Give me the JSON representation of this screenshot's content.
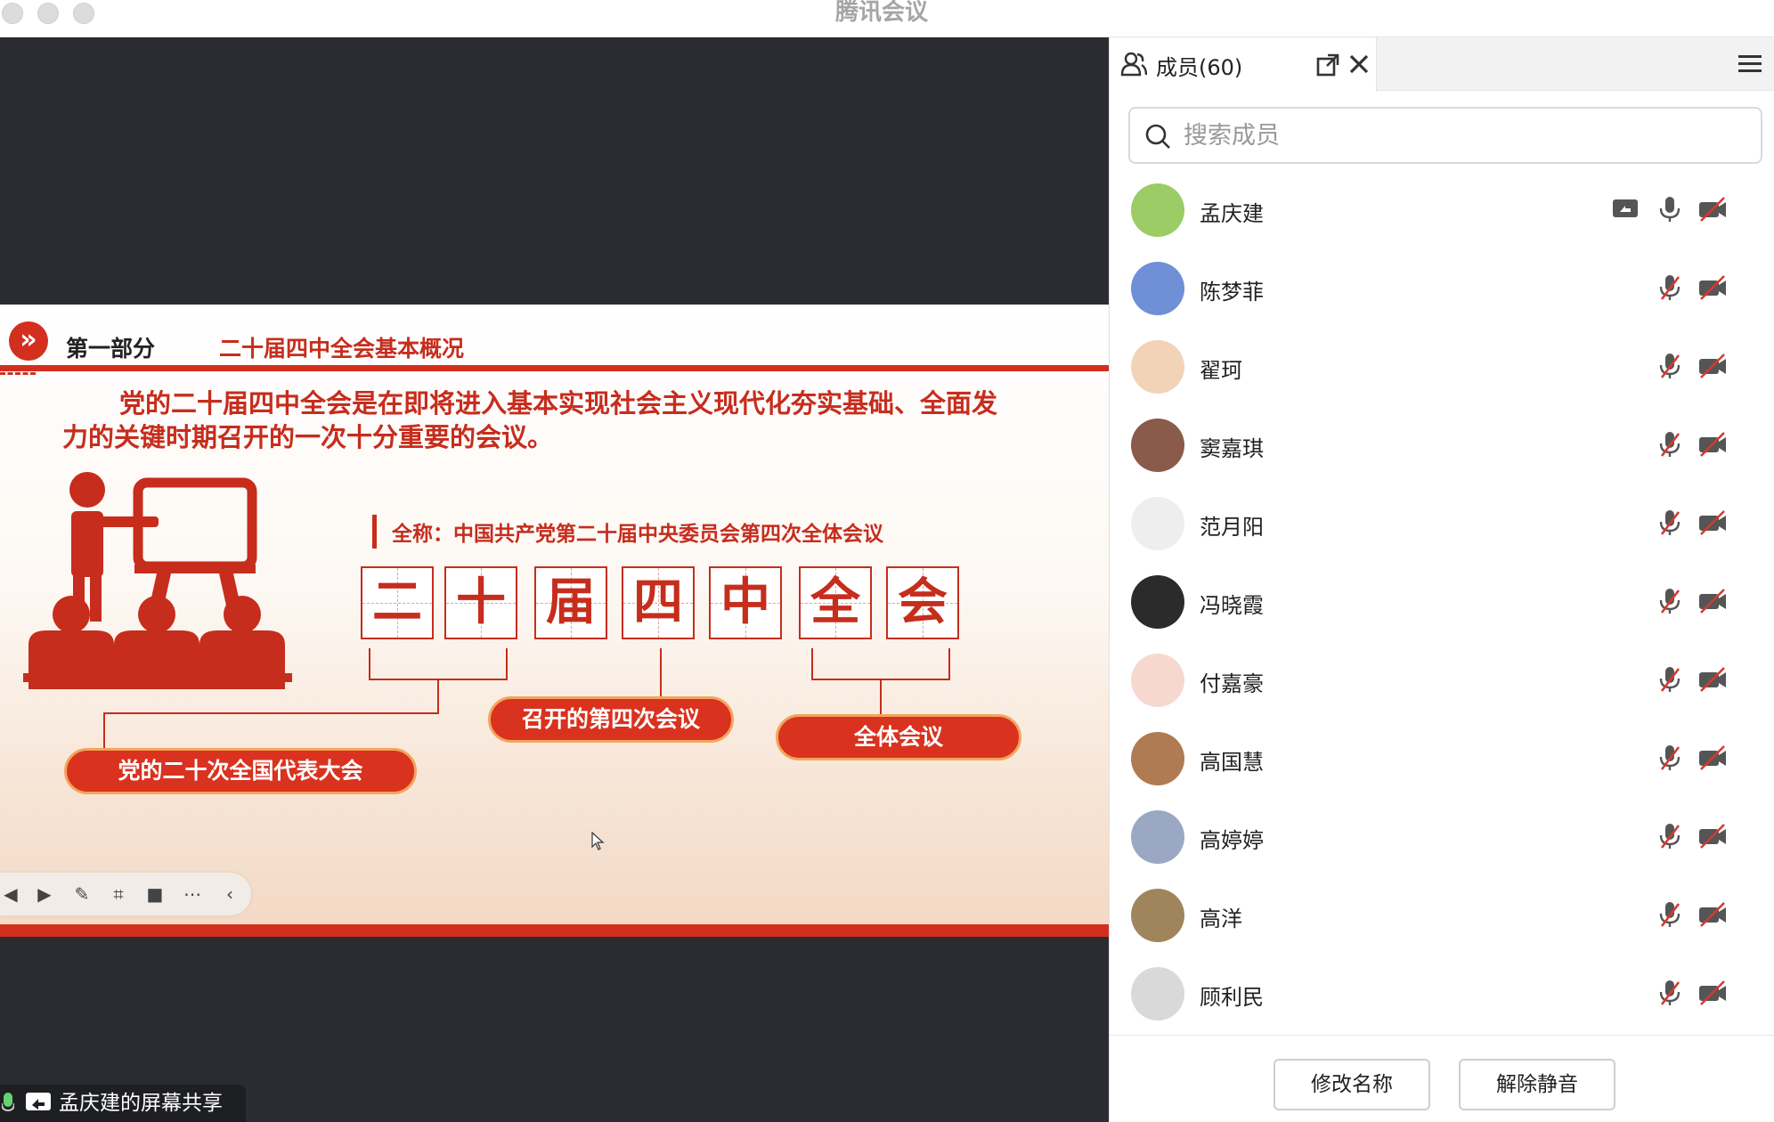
{
  "window": {
    "title": "腾讯会议"
  },
  "slide": {
    "badge": "»",
    "part_label": "第一部分",
    "part_title": "二十届四中全会基本概况",
    "intro": "党的二十届四中全会是在即将进入基本实现社会主义现代化夯实基础、全面发力的关键时期召开的一次十分重要的会议。",
    "full_name": "全称：中国共产党第二十届中央委员会第四次全体会议",
    "chars": [
      "二",
      "十",
      "届",
      "四",
      "中",
      "全",
      "会"
    ],
    "pills": {
      "congress": "党的二十次全国代表大会",
      "fourth": "召开的第四次会议",
      "plenary": "全体会议"
    }
  },
  "share_status": {
    "text": "孟庆建的屏幕共享"
  },
  "panel": {
    "tab_label": "成员(60)",
    "search_placeholder": "搜索成员",
    "members": [
      {
        "name": "孟庆建",
        "sharing": true,
        "mic_muted": false,
        "camera_off": true,
        "avatar_color": "#9ccc65"
      },
      {
        "name": "陈梦菲",
        "sharing": false,
        "mic_muted": true,
        "camera_off": true,
        "avatar_color": "#6f8fd6"
      },
      {
        "name": "翟珂",
        "sharing": false,
        "mic_muted": true,
        "camera_off": true,
        "avatar_color": "#f2d3b8"
      },
      {
        "name": "窦嘉琪",
        "sharing": false,
        "mic_muted": true,
        "camera_off": true,
        "avatar_color": "#8a5a4a"
      },
      {
        "name": "范月阳",
        "sharing": false,
        "mic_muted": true,
        "camera_off": true,
        "avatar_color": "#eeeeee"
      },
      {
        "name": "冯晓霞",
        "sharing": false,
        "mic_muted": true,
        "camera_off": true,
        "avatar_color": "#2b2b2b"
      },
      {
        "name": "付嘉豪",
        "sharing": false,
        "mic_muted": true,
        "camera_off": true,
        "avatar_color": "#f7d8cf"
      },
      {
        "name": "高国慧",
        "sharing": false,
        "mic_muted": true,
        "camera_off": true,
        "avatar_color": "#b07a52"
      },
      {
        "name": "高婷婷",
        "sharing": false,
        "mic_muted": true,
        "camera_off": true,
        "avatar_color": "#9aa8c4"
      },
      {
        "name": "高洋",
        "sharing": false,
        "mic_muted": true,
        "camera_off": true,
        "avatar_color": "#a0855c"
      },
      {
        "name": "顾利民",
        "sharing": false,
        "mic_muted": true,
        "camera_off": true,
        "avatar_color": "#d9d9d9"
      }
    ],
    "buttons": {
      "rename": "修改名称",
      "unmute": "解除静音"
    }
  }
}
